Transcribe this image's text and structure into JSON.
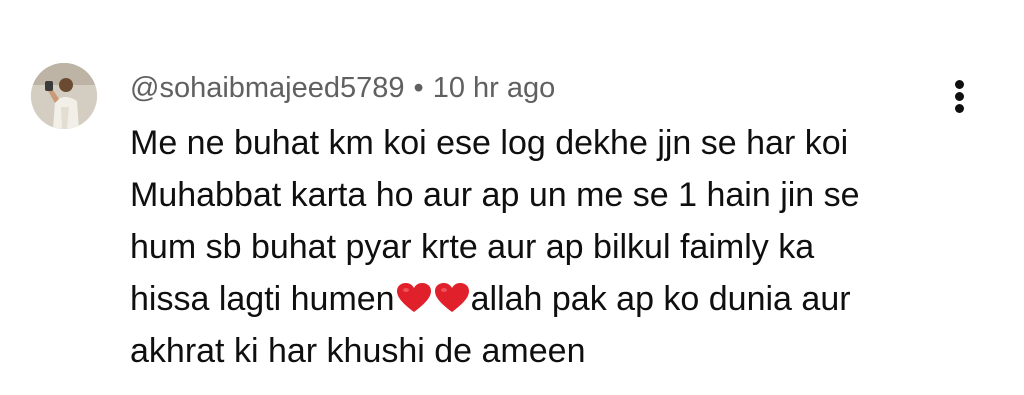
{
  "comment": {
    "author": "@sohaibmajeed5789",
    "separator": "•",
    "timestamp": "10 hr ago",
    "menu_icon": "more-vert-icon",
    "avatar_icon": "user-avatar-photo",
    "lines": [
      "Me ne buhat km koi ese log dekhe jjn se har koi",
      "Muhabbat karta ho aur ap un me se 1 hain jin se",
      "hum sb buhat pyar krte aur ap bilkul faimly ka"
    ],
    "line4": {
      "before": "hissa lagti humen",
      "emoji": "❤️❤️",
      "after": "allah pak ap ko dunia aur"
    },
    "line5": "akhrat ki har khushi de ameen"
  },
  "colors": {
    "heart": "#e0202a",
    "meta_text": "#606060",
    "body_text": "#0f0f0f"
  }
}
